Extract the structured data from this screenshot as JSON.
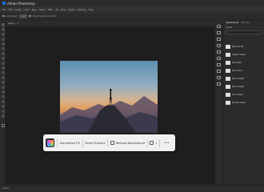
{
  "app": {
    "title": "Adobe Photoshop"
  },
  "menu": [
    "File",
    "Edit",
    "Image",
    "Layer",
    "Type",
    "Select",
    "Filter",
    "3D",
    "View",
    "Plugins",
    "Window",
    "Help"
  ],
  "options": [
    "Auto-Select:",
    "Layer",
    "Show Transform Controls"
  ],
  "document": {
    "tab_label": "Layer 1"
  },
  "taskbar": {
    "generative_fill": "Generative Fill",
    "select_subject": "Select Subject",
    "remove_background": "Remove Background",
    "count": "1",
    "more": "•••"
  },
  "panel": {
    "tabs": [
      "Adjustments",
      "Libraries"
    ],
    "subtitle": "Presets",
    "items": [
      "Blackout SE",
      "Subject Adjust",
      "Moody BS",
      "Moody Sky",
      "Warm Adjust",
      "Warm Adjust",
      "Cool Adjust",
      "Neutral Adjust"
    ]
  },
  "status": {
    "text": "Layer 1"
  },
  "colors": {
    "accent": "#1473e6",
    "taskbar_bg": "#f0f0f0",
    "ui_dark": "#2b2b2b"
  }
}
